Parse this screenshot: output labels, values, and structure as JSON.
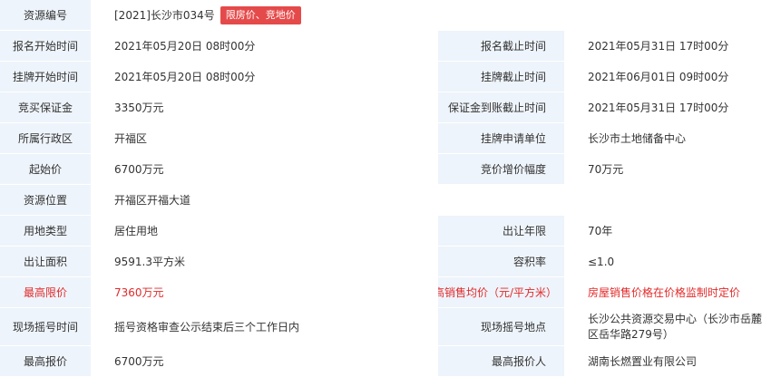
{
  "row1": {
    "label": "资源编号",
    "value": "[2021]长沙市034号",
    "tag": "限房价、竞地价"
  },
  "row2": {
    "l1": "报名开始时间",
    "v1": "2021年05月20日 08时00分",
    "l2": "报名截止时间",
    "v2": "2021年05月31日 17时00分"
  },
  "row3": {
    "l1": "挂牌开始时间",
    "v1": "2021年05月20日 08时00分",
    "l2": "挂牌截止时间",
    "v2": "2021年06月01日 09时00分"
  },
  "row4": {
    "l1": "竞买保证金",
    "v1": "3350万元",
    "l2": "保证金到账截止时间",
    "v2": "2021年05月31日 17时00分"
  },
  "row5": {
    "l1": "所属行政区",
    "v1": "开福区",
    "l2": "挂牌申请单位",
    "v2": "长沙市土地储备中心"
  },
  "row6": {
    "l1": "起始价",
    "v1": "6700万元",
    "l2": "竞价增价幅度",
    "v2": "70万元"
  },
  "row7": {
    "label": "资源位置",
    "value": "开福区开福大道"
  },
  "row8": {
    "l1": "用地类型",
    "v1": "居住用地",
    "l2": "出让年限",
    "v2": "70年"
  },
  "row9": {
    "l1": "出让面积",
    "v1": "9591.3平方米",
    "l2": "容积率",
    "v2": "≤1.0"
  },
  "row10": {
    "l1": "最高限价",
    "v1": "7360万元",
    "l2": "住宅(毛坯)最高销售均价（元/平方米）",
    "v2": "房屋销售价格在价格监制时定价"
  },
  "row11": {
    "l1": "现场摇号时间",
    "v1": "摇号资格审查公示结束后三个工作日内",
    "l2": "现场摇号地点",
    "v2": "长沙公共资源交易中心（长沙市岳麓区岳华路279号）"
  },
  "row12": {
    "l1": "最高报价",
    "v1": "6700万元",
    "l2": "最高报价人",
    "v2": "湖南长燃置业有限公司"
  }
}
